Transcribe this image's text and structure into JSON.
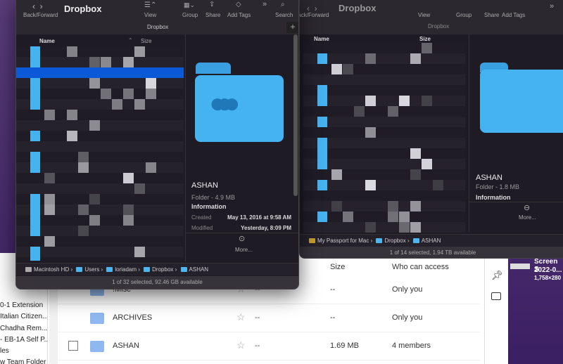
{
  "front_window": {
    "title": "Dropbox",
    "path_title": "Dropbox",
    "toolbar": {
      "back_forward": "Back/Forward",
      "view": "View",
      "group": "Group",
      "share": "Share",
      "add_tags": "Add Tags",
      "search": "Search"
    },
    "columns": {
      "name": "Name",
      "size": "Size"
    },
    "preview": {
      "name": "ASHAN",
      "kind": "Folder - 4.9 MB",
      "info_heading": "Information",
      "created_label": "Created",
      "created_value": "May 13, 2016 at 9:58 AM",
      "modified_label": "Modified",
      "modified_value": "Yesterday, 8:09 PM",
      "more": "More..."
    },
    "path": [
      "Macintosh HD",
      "Users",
      "loriadam",
      "Dropbox",
      "ASHAN"
    ],
    "status": "1 of 32 selected, 92.46 GB available"
  },
  "back_window": {
    "title": "Dropbox",
    "path_title": "Dropbox",
    "toolbar": {
      "back_forward": "Back/Forward",
      "view": "View",
      "group": "Group",
      "share": "Share",
      "add_tags": "Add Tags"
    },
    "columns": {
      "name": "Name",
      "size": "Size"
    },
    "preview": {
      "name": "ASHAN",
      "kind": "Folder - 1.8 MB",
      "info_heading": "Information",
      "more": "More..."
    },
    "path": [
      "My Passport for Mac",
      "Dropbox",
      "ASHAN"
    ],
    "status": "1 of 14 selected, 1.94 TB available"
  },
  "web": {
    "columns": {
      "size": "Size",
      "access": "Who can access"
    },
    "rows": [
      {
        "name": "!Misc",
        "modified": "--",
        "size": "--",
        "access": "Only you"
      },
      {
        "name": "ARCHIVES",
        "modified": "--",
        "size": "--",
        "access": "Only you"
      },
      {
        "name": "ASHAN",
        "modified": "--",
        "size": "1.69 MB",
        "access": "4 members"
      }
    ],
    "sidebar": [
      "0-1 Extension",
      "Italian Citizen...",
      "Chadha Rem...",
      "- EB-1A Self P...",
      "les",
      "w Team Folder"
    ]
  },
  "desktop": {
    "thumb_title": "Screen S",
    "thumb_date": "2022-0...",
    "thumb_dims": "1,758×280"
  },
  "colors": {
    "accent": "#0a5ad8",
    "folder": "#45b3f0"
  }
}
